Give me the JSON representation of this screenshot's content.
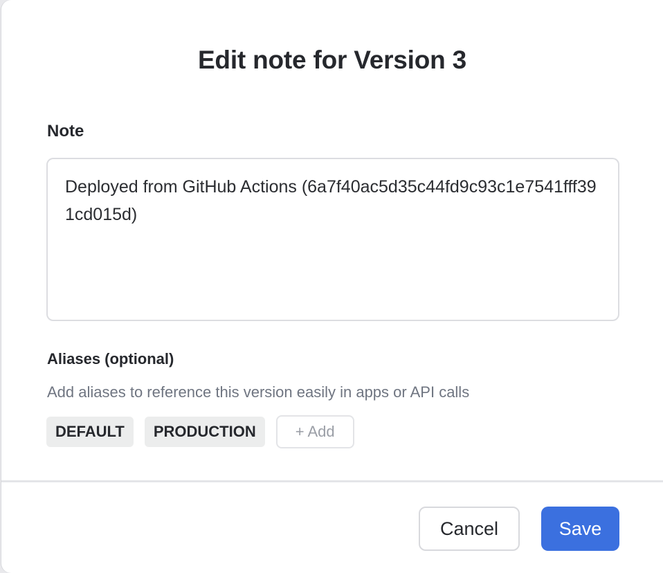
{
  "dialog": {
    "title": "Edit note for Version 3",
    "note_label": "Note",
    "note_value": "Deployed from GitHub Actions (6a7f40ac5d35c44fd9c93c1e7541fff391cd015d)",
    "aliases_label": "Aliases (optional)",
    "aliases_help": "Add aliases to reference this version easily in apps or API calls",
    "aliases": [
      "DEFAULT",
      "PRODUCTION"
    ],
    "add_alias_label": "+ Add",
    "cancel_label": "Cancel",
    "save_label": "Save"
  },
  "colors": {
    "primary": "#3b70df",
    "muted_text": "#6f7581",
    "chip_bg": "#eceded"
  }
}
